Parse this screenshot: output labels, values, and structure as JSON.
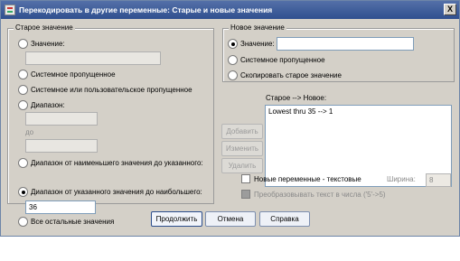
{
  "window": {
    "title": "Перекодировать в другие переменные: Старые и новые значения",
    "close_glyph": "X"
  },
  "old_value": {
    "group_label": "Старое значение",
    "value_label": "Значение:",
    "system_missing_label": "Системное пропущенное",
    "system_or_user_missing_label": "Системное или пользовательское пропущенное",
    "range_label": "Диапазон:",
    "through_label": "до",
    "range_lowest_label": "Диапазон от наименьшего значения до указанного:",
    "range_highest_label": "Диапазон от указанного значения до наибольшего:",
    "range_highest_value": "36",
    "all_other_label": "Все остальные значения",
    "selected": "range_highest"
  },
  "new_value": {
    "group_label": "Новое значение",
    "value_label": "Значение:",
    "value_input": "",
    "system_missing_label": "Системное пропущенное",
    "copy_old_label": "Скопировать старое значение",
    "selected": "value"
  },
  "mapping": {
    "label": "Старое --> Новое:",
    "items": [
      "Lowest thru 35 --> 1"
    ]
  },
  "mapping_buttons": {
    "add": "Добавить",
    "change": "Изменить",
    "remove": "Удалить"
  },
  "options": {
    "string_output_label": "Новые переменные - текстовые",
    "width_label": "Ширина:",
    "width_value": "8",
    "convert_numeric_label": "Преобразовывать текст в числа ('5'->5)"
  },
  "footer": {
    "continue": "Продолжить",
    "cancel": "Отмена",
    "help": "Справка"
  }
}
